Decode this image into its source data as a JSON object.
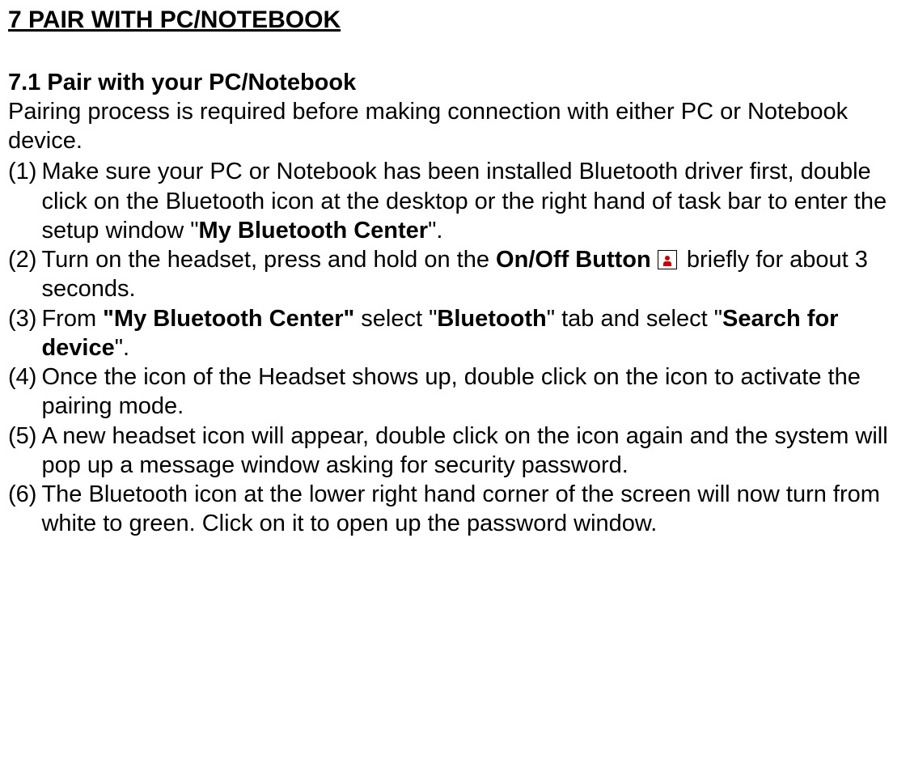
{
  "heading": "7 PAIR WITH PC/NOTEBOOK",
  "subheading": "7.1 Pair with your PC/Notebook",
  "intro": "Pairing process is required before making connection with either PC or Notebook device.",
  "steps": {
    "s1": {
      "num": "(1)",
      "pre": "Make sure your PC or Notebook has been installed Bluetooth driver first, double click on the Bluetooth icon at the desktop or the right hand of task bar to enter the setup window \"",
      "bold": "My Bluetooth Center",
      "post": "\"."
    },
    "s2": {
      "num": "(2)",
      "pre": "Turn on the headset, press and hold on the ",
      "bold": "On/Off Button",
      "post": " briefly for about 3 seconds."
    },
    "s3": {
      "num": "(3)",
      "t1": "From ",
      "b1": "\"My Bluetooth Center\"",
      "t2": " select \"",
      "b2": "Bluetooth",
      "t3": "\" tab and select \"",
      "b3": "Search for device",
      "t4": "\"."
    },
    "s4": {
      "num": "(4)",
      "text": "Once the icon of the Headset shows up, double click on the icon to activate the pairing mode."
    },
    "s5": {
      "num": "(5)",
      "text": "A new headset icon will appear, double click on the icon again and the system will pop up a message window asking for security password."
    },
    "s6": {
      "num": "(6)",
      "text": "The Bluetooth icon at the lower right hand corner of the screen will now turn from white to green. Click on it to open up the password window."
    }
  }
}
